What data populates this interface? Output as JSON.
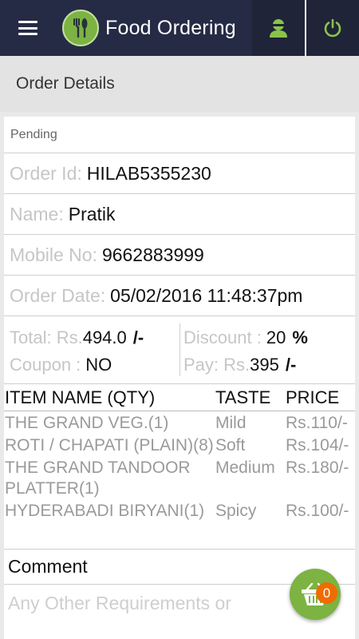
{
  "app": {
    "title": "Food Ordering"
  },
  "page": {
    "section_title": "Order Details"
  },
  "order": {
    "status": "Pending",
    "order_id_label": "Order Id:",
    "order_id": "HILAB5355230",
    "name_label": "Name:",
    "name": "Pratik",
    "mobile_label": "Mobile No:",
    "mobile": "9662883999",
    "date_label": "Order Date:",
    "date": "05/02/2016 11:48:37pm",
    "total_label": "Total: Rs.",
    "total": "494.0",
    "total_unit": "/-",
    "discount_label": "Discount :",
    "discount": "20",
    "discount_unit": "%",
    "coupon_label": "Coupon :",
    "coupon": "NO",
    "pay_label": "Pay: Rs.",
    "pay": "395",
    "pay_unit": "/-"
  },
  "items": {
    "headers": {
      "name": "ITEM NAME (QTY)",
      "taste": "TASTE",
      "price": "PRICE"
    },
    "rows": [
      {
        "name": "THE GRAND VEG.(1)",
        "taste": "Mild",
        "price": "Rs.110/-"
      },
      {
        "name": "ROTI / CHAPATI (PLAIN)(8)",
        "taste": "Soft",
        "price": "Rs.104/-"
      },
      {
        "name": "THE GRAND TANDOOR PLATTER(1)",
        "taste": "Medium",
        "price": "Rs.180/-"
      },
      {
        "name": "HYDERABADI BIRYANI(1)",
        "taste": "Spicy",
        "price": "Rs.100/-"
      }
    ]
  },
  "comment": {
    "label": "Comment",
    "placeholder": "Any Other Requirements or"
  },
  "cart": {
    "count": "0"
  },
  "icons": {
    "menu": "hamburger-menu-icon",
    "logo": "fork-knife-icon",
    "profile": "user-icon",
    "power": "power-icon",
    "cart": "basket-icon"
  },
  "colors": {
    "topbar": "#262b45",
    "accent": "#7cb342",
    "badge": "#ef6c00"
  }
}
